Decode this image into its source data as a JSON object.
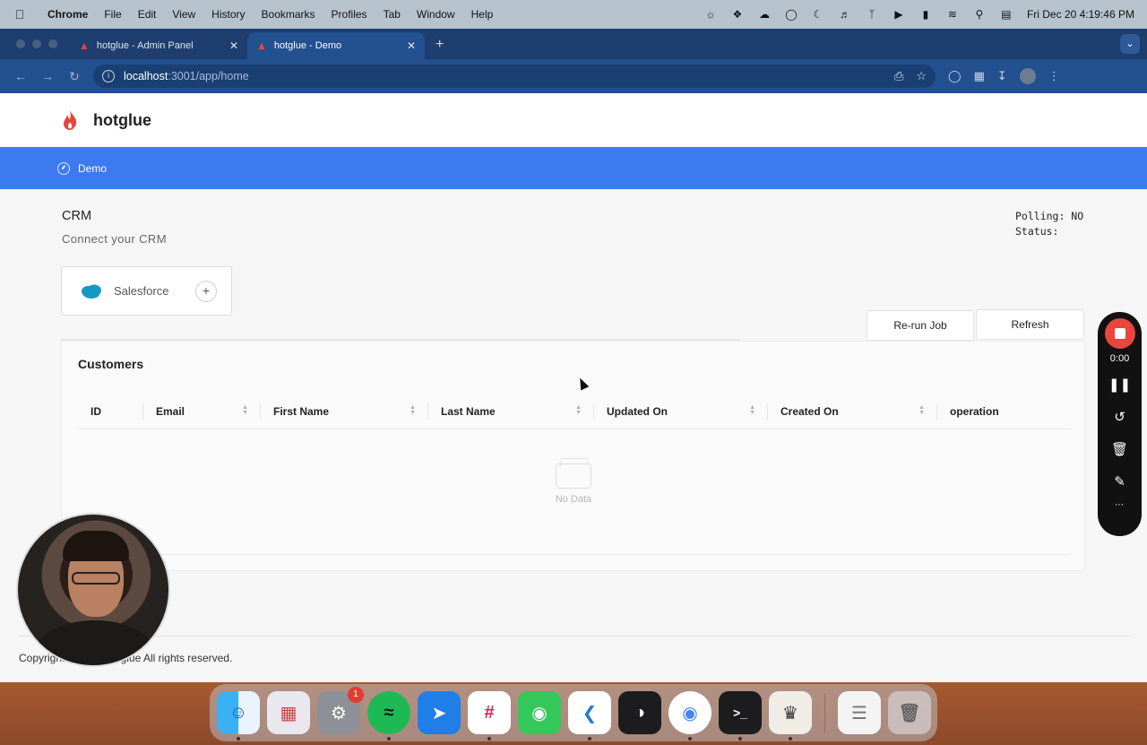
{
  "menubar": {
    "app": "Chrome",
    "items": [
      "File",
      "Edit",
      "View",
      "History",
      "Bookmarks",
      "Profiles",
      "Tab",
      "Window",
      "Help"
    ],
    "clock": "Fri Dec 20  4:19:46 PM",
    "status_icons": [
      "brightness-icon",
      "dropbox-icon",
      "cloud-icon",
      "onepassword-icon",
      "moon-icon",
      "volume-icon",
      "bluetooth-icon",
      "play-icon",
      "battery-icon",
      "wifi-icon",
      "search-icon",
      "control-center-icon"
    ]
  },
  "browser": {
    "tabs": [
      {
        "label": "hotglue - Admin Panel",
        "active": false
      },
      {
        "label": "hotglue - Demo",
        "active": true
      }
    ],
    "url_host": "localhost",
    "url_path": ":3001/app/home"
  },
  "app": {
    "brand": "hotglue",
    "nav_item": "Demo",
    "accent": "#3c7af0"
  },
  "crm": {
    "title": "CRM",
    "subtitle": "Connect  your  CRM",
    "polling": "Polling: NO",
    "status": "Status:",
    "connector": "Salesforce",
    "connector_action": "+"
  },
  "buttons": {
    "rerun": "Re-run Job",
    "refresh": "Refresh"
  },
  "table": {
    "title": "Customers",
    "columns": [
      "ID",
      "Email",
      "First Name",
      "Last Name",
      "Updated On",
      "Created On",
      "operation"
    ],
    "empty_text": "No Data"
  },
  "footer": {
    "text": "Copyright © 2024 hotglue All rights reserved."
  },
  "recorder": {
    "time": "0:00",
    "stop_color": "#e8463c"
  },
  "dock": {
    "apps": [
      "Finder",
      "Launchpad",
      "System Settings",
      "Spotify",
      "Spark",
      "Slack",
      "Messages",
      "Visual Studio Code",
      "Linear",
      "Chrome",
      "Terminal",
      "CE",
      "TextEdit",
      "Trash"
    ],
    "settings_badge": "1"
  }
}
